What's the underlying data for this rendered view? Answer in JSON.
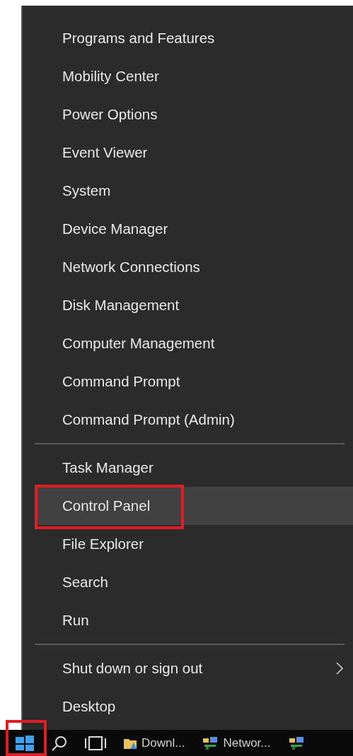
{
  "menu": {
    "sections": [
      {
        "items": [
          {
            "label": "Programs and Features",
            "selected": false,
            "annotated": false,
            "submenu": false
          },
          {
            "label": "Mobility Center",
            "selected": false,
            "annotated": false,
            "submenu": false
          },
          {
            "label": "Power Options",
            "selected": false,
            "annotated": false,
            "submenu": false
          },
          {
            "label": "Event Viewer",
            "selected": false,
            "annotated": false,
            "submenu": false
          },
          {
            "label": "System",
            "selected": false,
            "annotated": false,
            "submenu": false
          },
          {
            "label": "Device Manager",
            "selected": false,
            "annotated": false,
            "submenu": false
          },
          {
            "label": "Network Connections",
            "selected": false,
            "annotated": false,
            "submenu": false
          },
          {
            "label": "Disk Management",
            "selected": false,
            "annotated": false,
            "submenu": false
          },
          {
            "label": "Computer Management",
            "selected": false,
            "annotated": false,
            "submenu": false
          },
          {
            "label": "Command Prompt",
            "selected": false,
            "annotated": false,
            "submenu": false
          },
          {
            "label": "Command Prompt (Admin)",
            "selected": false,
            "annotated": false,
            "submenu": false
          }
        ]
      },
      {
        "items": [
          {
            "label": "Task Manager",
            "selected": false,
            "annotated": false,
            "submenu": false
          },
          {
            "label": "Control Panel",
            "selected": true,
            "annotated": true,
            "submenu": false
          },
          {
            "label": "File Explorer",
            "selected": false,
            "annotated": false,
            "submenu": false
          },
          {
            "label": "Search",
            "selected": false,
            "annotated": false,
            "submenu": false
          },
          {
            "label": "Run",
            "selected": false,
            "annotated": false,
            "submenu": false
          }
        ]
      },
      {
        "items": [
          {
            "label": "Shut down or sign out",
            "selected": false,
            "annotated": false,
            "submenu": true
          },
          {
            "label": "Desktop",
            "selected": false,
            "annotated": false,
            "submenu": false
          }
        ]
      }
    ]
  },
  "taskbar": {
    "items": [
      {
        "kind": "start",
        "annotated": true
      },
      {
        "kind": "search"
      },
      {
        "kind": "taskview"
      },
      {
        "kind": "folder",
        "label": "Downl..."
      },
      {
        "kind": "network",
        "label": "Networ..."
      },
      {
        "kind": "network"
      }
    ]
  }
}
